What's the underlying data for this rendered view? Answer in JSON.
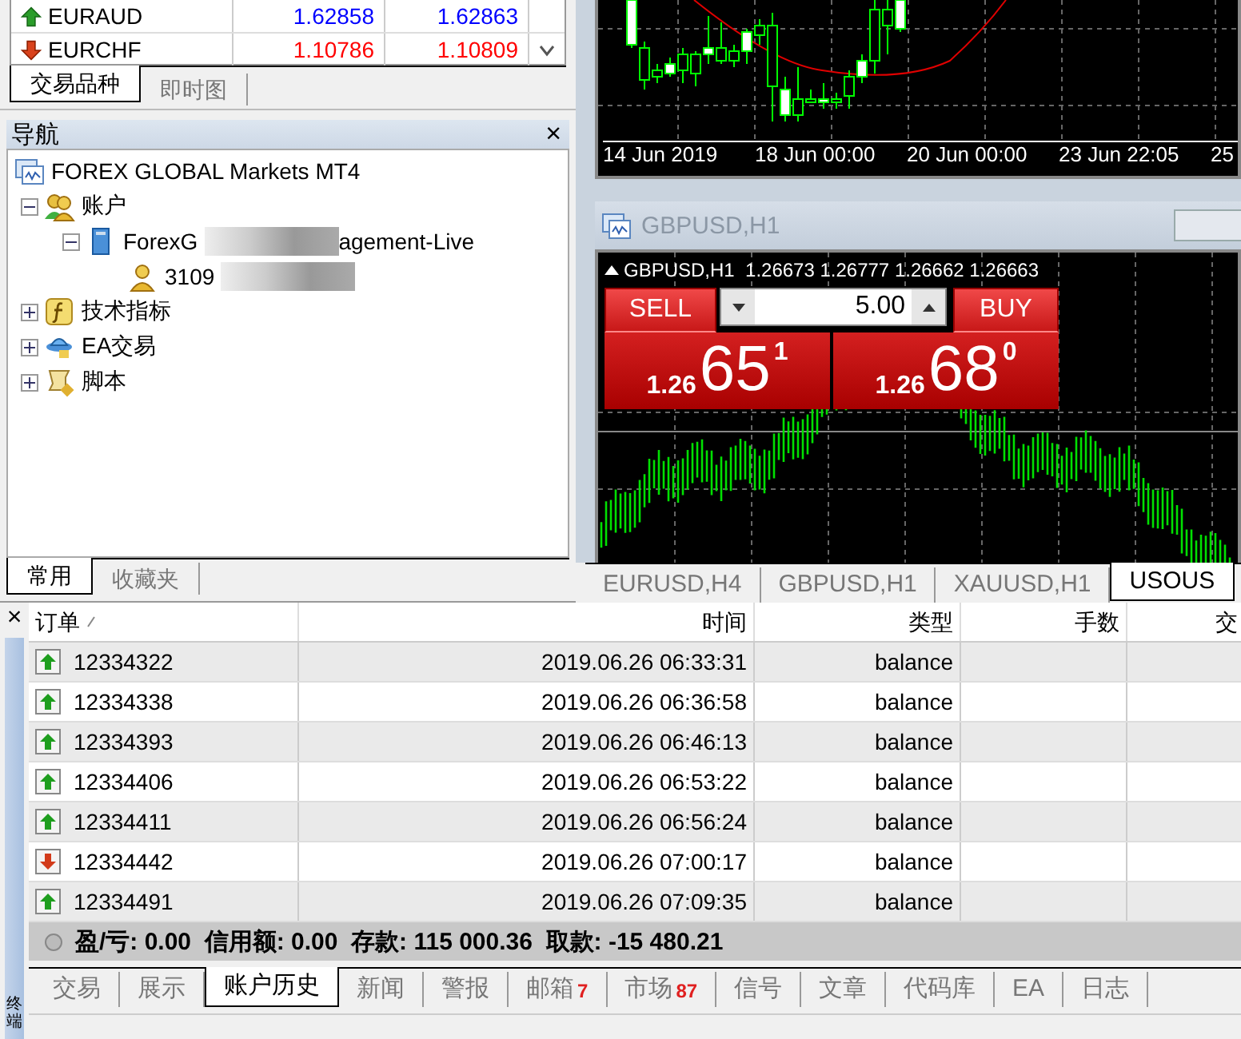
{
  "market_watch": {
    "rows": [
      {
        "kind": "up",
        "symbol": "EURAUD",
        "bid": "1.62858",
        "ask": "1.62863",
        "color": "#0000ff"
      },
      {
        "kind": "down",
        "symbol": "EURCHF",
        "bid": "1.10786",
        "ask": "1.10809",
        "color": "#ff0000"
      }
    ],
    "tabs": [
      {
        "label": "交易品种",
        "selected": true
      },
      {
        "label": "即时图",
        "selected": false
      }
    ]
  },
  "navigator": {
    "title": "导航",
    "close": "×",
    "tree": [
      {
        "kind": "terminal",
        "label": "FOREX GLOBAL Markets MT4",
        "children": [
          {
            "kind": "accounts",
            "label": "账户",
            "expanded": true,
            "children": [
              {
                "kind": "server",
                "label": "ForexG",
                "hidden_part": true,
                "label_tail": "agement-Live",
                "expanded": true,
                "children": [
                  {
                    "kind": "account",
                    "label": "3109",
                    "hidden_part": true
                  }
                ]
              }
            ]
          },
          {
            "kind": "indicators",
            "label": "技术指标",
            "expanded": false
          },
          {
            "kind": "experts",
            "label": "EA交易",
            "expanded": false
          },
          {
            "kind": "scripts",
            "label": "脚本",
            "expanded": false
          }
        ]
      }
    ],
    "tabs": [
      {
        "label": "常用",
        "selected": true
      },
      {
        "label": "收藏夹",
        "selected": false
      }
    ]
  },
  "chart_top": {
    "time_labels": [
      "14 Jun 2019",
      "18 Jun 00:00",
      "20 Jun 00:00",
      "23 Jun 22:05",
      "25"
    ]
  },
  "chart_window": {
    "title": "GBPUSD,H1",
    "header": "GBPUSD,H1  1.26673 1.26777 1.26662 1.26663",
    "one_click": {
      "sell_label": "SELL",
      "buy_label": "BUY",
      "volume": "5.00",
      "sell": {
        "prefix": "1.26",
        "big": "65",
        "sup": "1"
      },
      "buy": {
        "prefix": "1.26",
        "big": "68",
        "sup": "0"
      }
    }
  },
  "chart_tabs": [
    {
      "label": "EURUSD,H4",
      "selected": false
    },
    {
      "label": "GBPUSD,H1",
      "selected": false
    },
    {
      "label": "XAUUSD,H1",
      "selected": false
    },
    {
      "label": "USOUS",
      "selected": true
    }
  ],
  "terminal": {
    "close": "×",
    "side_label": "终端",
    "columns": [
      "订单",
      "时间",
      "类型",
      "手数",
      "交"
    ],
    "rows": [
      {
        "kind": "up",
        "order": "12334322",
        "time": "2019.06.26 06:33:31",
        "type": "balance"
      },
      {
        "kind": "up",
        "order": "12334338",
        "time": "2019.06.26 06:36:58",
        "type": "balance"
      },
      {
        "kind": "up",
        "order": "12334393",
        "time": "2019.06.26 06:46:13",
        "type": "balance"
      },
      {
        "kind": "up",
        "order": "12334406",
        "time": "2019.06.26 06:53:22",
        "type": "balance"
      },
      {
        "kind": "up",
        "order": "12334411",
        "time": "2019.06.26 06:56:24",
        "type": "balance"
      },
      {
        "kind": "down",
        "order": "12334442",
        "time": "2019.06.26 07:00:17",
        "type": "balance"
      },
      {
        "kind": "up",
        "order": "12334491",
        "time": "2019.06.26 07:09:35",
        "type": "balance"
      }
    ],
    "summary": "盈/亏: 0.00  信用额: 0.00  存款: 115 000.36  取款: -15 480.21",
    "tabs": [
      {
        "label": "交易",
        "selected": false
      },
      {
        "label": "展示",
        "selected": false
      },
      {
        "label": "账户历史",
        "selected": true
      },
      {
        "label": "新闻",
        "selected": false
      },
      {
        "label": "警报",
        "selected": false
      },
      {
        "label": "邮箱",
        "badge": "7",
        "selected": false
      },
      {
        "label": "市场",
        "badge": "87",
        "selected": false
      },
      {
        "label": "信号",
        "selected": false
      },
      {
        "label": "文章",
        "selected": false
      },
      {
        "label": "代码库",
        "selected": false
      },
      {
        "label": "EA",
        "selected": false
      },
      {
        "label": "日志",
        "selected": false
      }
    ]
  }
}
